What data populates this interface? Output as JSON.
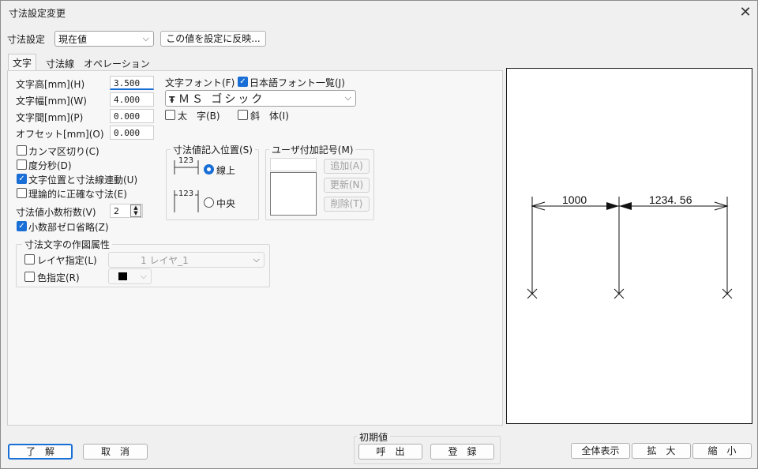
{
  "window": {
    "title": "寸法設定変更",
    "close_label": "✕"
  },
  "header": {
    "preset_label": "寸法設定",
    "preset_value": "現在値",
    "apply_button": "この値を設定に反映..."
  },
  "tabs": [
    {
      "label": "文字"
    },
    {
      "label": "寸法線"
    },
    {
      "label": "オペレーション"
    }
  ],
  "text_tab": {
    "height_label": "文字高[mm](H)",
    "height_value": "3.500",
    "width_label": "文字幅[mm](W)",
    "width_value": "4.000",
    "spacing_label": "文字間[mm](P)",
    "spacing_value": "0.000",
    "offset_label": "オフセット[mm](O)",
    "offset_value": "0.000",
    "comma_label": "カンマ区切り(C)",
    "dms_label": "度分秒(D)",
    "linked_label": "文字位置と寸法線連動(U)",
    "exact_label": "理論的に正確な寸法(E)",
    "decimals_label": "寸法値小数桁数(V)",
    "decimals_value": "2",
    "omit_zero_label": "小数部ゼロ省略(Z)",
    "font_label": "文字フォント(F)",
    "jp_font_label": "日本語フォント一覧(J)",
    "font_value": "ＭＳ ゴシック",
    "font_icon": "Ŧ",
    "bold_label": "太　字(B)",
    "italic_label": "斜　体(I)",
    "pos_group_title": "寸法値記入位置(S)",
    "pos_sample": "123",
    "pos_on_line": "線上",
    "pos_center": "中央",
    "user_sym_title": "ユーザ付加記号(M)",
    "add_btn": "追加(A)",
    "update_btn": "更新(N)",
    "delete_btn": "削除(T)",
    "attr_group_title": "寸法文字の作図属性",
    "layer_label": "レイヤ指定(L)",
    "layer_value": "1 レイヤ_1",
    "color_label": "色指定(R)"
  },
  "preview": {
    "dim1": "1000",
    "dim2": "1234. 56"
  },
  "footer": {
    "ok": "了　解",
    "cancel": "取　消",
    "initial_title": "初期値",
    "load": "呼　出",
    "register": "登　録",
    "fit": "全体表示",
    "zoom_in": "拡　大",
    "zoom_out": "縮　小"
  },
  "colors": {
    "accent": "#1a6fd6",
    "swatch": "#000000"
  }
}
